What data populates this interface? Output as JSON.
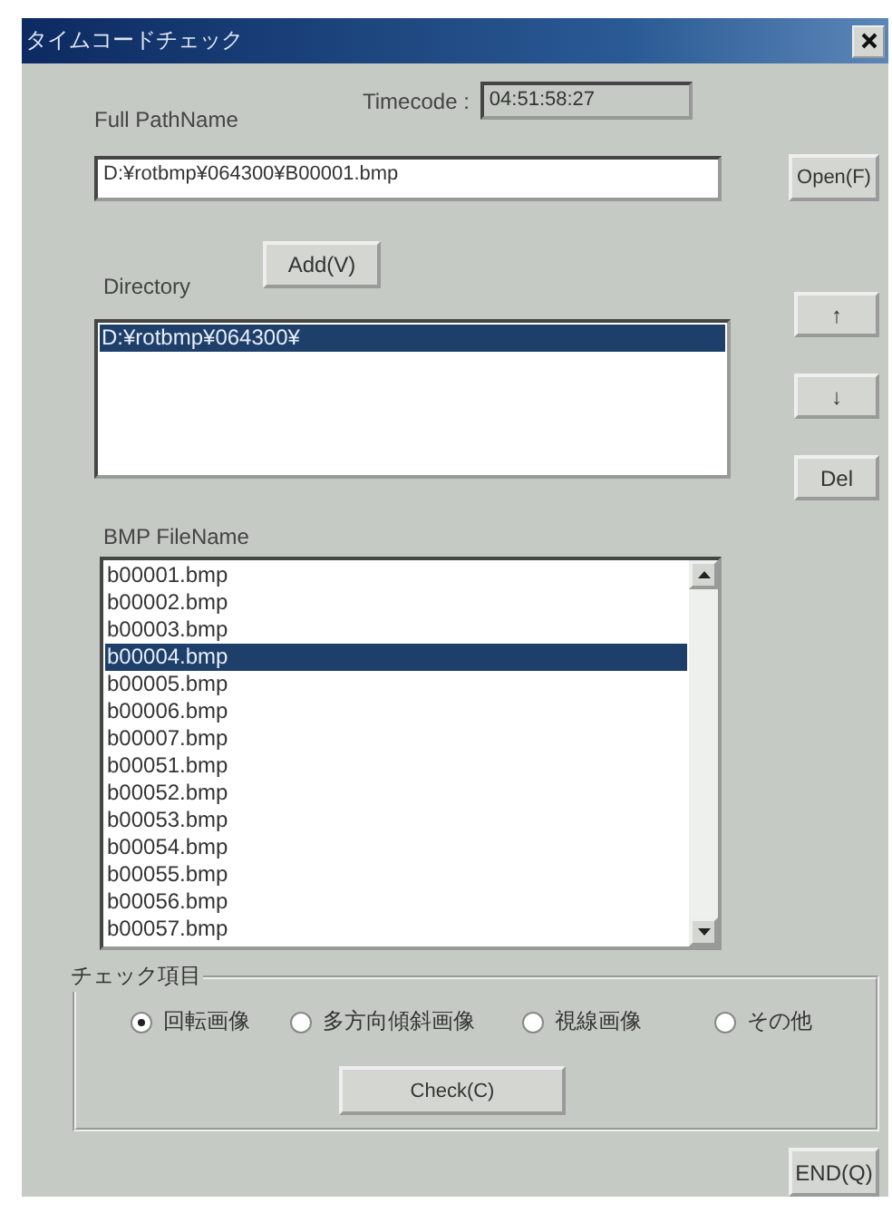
{
  "window": {
    "title": "タイムコードチェック"
  },
  "full_path": {
    "label": "Full PathName",
    "value": "D:¥rotbmp¥064300¥B00001.bmp"
  },
  "timecode": {
    "label": "Timecode :",
    "value": "04:51:58:27"
  },
  "open_button": "Open(F)",
  "directory": {
    "label": "Directory",
    "add_button": "Add(V)",
    "items": [
      {
        "text": "D:¥rotbmp¥064300¥",
        "selected": true
      }
    ]
  },
  "side_buttons": [
    "↑",
    "↓",
    "Del"
  ],
  "bmp_files": {
    "label": "BMP FileName",
    "items": [
      {
        "text": "b00001.bmp",
        "selected": false
      },
      {
        "text": "b00002.bmp",
        "selected": false
      },
      {
        "text": "b00003.bmp",
        "selected": false
      },
      {
        "text": "b00004.bmp",
        "selected": true
      },
      {
        "text": "b00005.bmp",
        "selected": false
      },
      {
        "text": "b00006.bmp",
        "selected": false
      },
      {
        "text": "b00007.bmp",
        "selected": false
      },
      {
        "text": "b00051.bmp",
        "selected": false
      },
      {
        "text": "b00052.bmp",
        "selected": false
      },
      {
        "text": "b00053.bmp",
        "selected": false
      },
      {
        "text": "b00054.bmp",
        "selected": false
      },
      {
        "text": "b00055.bmp",
        "selected": false
      },
      {
        "text": "b00056.bmp",
        "selected": false
      },
      {
        "text": "b00057.bmp",
        "selected": false
      }
    ]
  },
  "check_items": {
    "label": "チェック項目",
    "options": [
      {
        "label": "回転画像",
        "selected": true
      },
      {
        "label": "多方向傾斜画像",
        "selected": false
      },
      {
        "label": "視線画像",
        "selected": false
      },
      {
        "label": "その他",
        "selected": false
      }
    ],
    "check_button": "Check(C)"
  },
  "end_button": "END(Q)"
}
